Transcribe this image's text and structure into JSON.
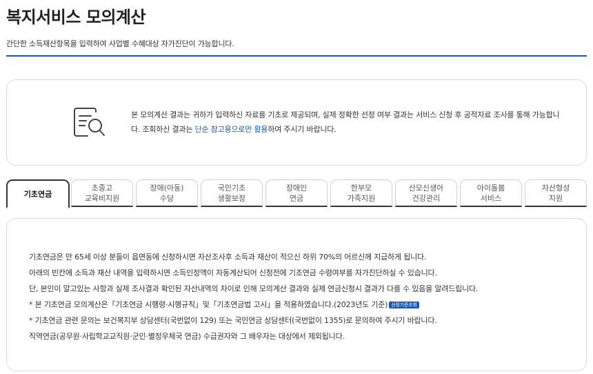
{
  "page": {
    "title": "복지서비스 모의계산",
    "subtitle": "간단한 소득재산항목을 입력하여 사업별 수혜대상 자가진단이 가능합니다."
  },
  "notice": {
    "icon": "document-search-icon",
    "text_part1": "본 모의계산 결과는 귀하가 입력하신 자료를 기초로 제공되며, 실제 정확한 선정 여부 결과는 서비스 신청 후 공적자료 조사를 통해 가능합니다. 조회하신 결과는 ",
    "highlight": "단순 참고용으로만 활용",
    "text_part2": "하여 주시기 바랍니다."
  },
  "tabs": [
    {
      "label": "기초연금",
      "active": true
    },
    {
      "label": "초중고\n교육비지원",
      "active": false
    },
    {
      "label": "장애(아동)\n수당",
      "active": false
    },
    {
      "label": "국민기초\n생활보장",
      "active": false
    },
    {
      "label": "장애인\n연금",
      "active": false
    },
    {
      "label": "한부모\n가족지원",
      "active": false
    },
    {
      "label": "산모신생아\n건강관리",
      "active": false
    },
    {
      "label": "아이돌봄\n서비스",
      "active": false
    },
    {
      "label": "자산형성\n지원",
      "active": false
    }
  ],
  "content": {
    "line1": "기초연금은 만 65세 이상 분들이 읍면동에 신청하시면 자산조사후 소득과 재산이 적으신 하위 70%의 어르신께 지급하게 됩니다.",
    "line2": "아래의 빈칸에 소득과 재산 내역을 입력하시면 소득인정액이 자동계산되어 신청전에 기초연금 수령여부를 자가진단하실 수 있습니다.",
    "line3": "단, 본인이 알고있는 사항과 실제 조사결과 확인된 자산내역의 차이로 인해 모의계산 결과와 실제 연금신청시 결과가 다를 수 있음을 알려드립니다.",
    "line4": "* 본 기초연금 모의계산은「기초연금 시행령·시행규칙」및「기초연금법 고시」을 적용하였습니다.(2023년도 기준)",
    "badge": "선정기준조회",
    "line5": "* 기초연금 관련 문의는 보건복지부 상담센터(국번없이 129) 또는 국민연금 상담센터(국번없이 1355)로 문의하여 주시기 바랍니다.",
    "line6": "직역연금(공무원·사립학교교직원·군인·별정우체국 연금) 수급권자와 그 배우자는 대상에서 제외됩니다."
  }
}
